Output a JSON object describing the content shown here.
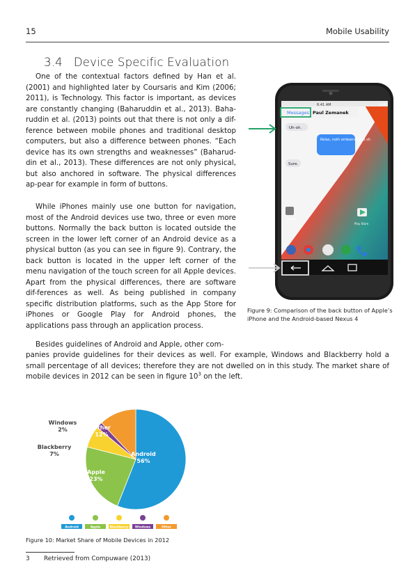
{
  "header": {
    "page_number": "15",
    "running_title": "Mobile Usability"
  },
  "section": {
    "number": "3.4",
    "title": "Device Specific Evaluation"
  },
  "paragraphs": {
    "p1": "One of the contextual factors defined by Han et al. (2001) and highlighted later by Coursaris and Kim (2006; 2011), is Technology. This factor is important, as devices are constantly changing (Baharuddin et al., 2013). Baha-ruddin et al. (2013) points out that there is not only a dif-ference between mobile phones and traditional desktop computers, but also a difference between phones. “Each device has its own strengths and weaknesses” (Baharud-din et al., 2013). These differences are not only physical, but also anchored in software. The physical differences ap-pear for example in form of buttons.",
    "p2": "While iPhones mainly use one button for navigation, most of the Android devices use two, three or even more buttons. Normally the back button is located outside the screen in the lower left corner of an Android device as a physical button (as you can see in figure 9). Contrary, the back button is located in the upper left corner of the menu navigation of the touch screen for all Apple devices. Apart from the physical differences, there are software dif-ferences as well. As being published in company specific distribution platforms, such as the App Store for iPhones or Google Play for Android phones, the applications pass through an application process.",
    "p3": "Besides guidelines of Android and Apple, other com-",
    "p3_cont": "panies provide guidelines for their devices as well. For example, Windows and Blackberry hold a small percentage of all devices; therefore they are not dwelled on in this study. The market share of mobile devices in 2012 can be seen in figure 10",
    "p3_sup": "3",
    "p3_end": " on the left."
  },
  "phone": {
    "status_time": "6:41 AM",
    "status_time_right": "4:40",
    "back_label": "Messages",
    "contact": "Paul Zemanek",
    "bubble1": "Uh-oh.",
    "bubble2": "Relax, noth embarras you sh",
    "bubble3": "Sure.",
    "google_label": "Google",
    "playstore_label": "Play Store"
  },
  "figures": {
    "fig9_caption": "Figure 9: Comparison of the back button of Apple’s iPhone and the Android-based Nexus 4",
    "fig10_caption": "Figure 10: Market Share of Mobile Devices in 2012"
  },
  "chart_data": {
    "type": "pie",
    "title": "",
    "slices": [
      {
        "name": "Android",
        "value": 56,
        "label": "56%",
        "color": "#1f9ad6"
      },
      {
        "name": "Apple",
        "value": 23,
        "label": "23%",
        "color": "#8cc34a"
      },
      {
        "name": "Blackberry",
        "value": 7,
        "label": "7%",
        "color": "#f8d22f"
      },
      {
        "name": "Windows",
        "value": 2,
        "label": "2%",
        "color": "#7b3f96"
      },
      {
        "name": "Other",
        "value": 12,
        "label": "12%",
        "color": "#f29a2e"
      }
    ],
    "legend": [
      "Android",
      "Apple",
      "Blackberry",
      "Windows",
      "Other"
    ],
    "legend_placement": "bottom"
  },
  "footnote": {
    "number": "3",
    "text": "Retrieved from Compuware (2013)"
  }
}
